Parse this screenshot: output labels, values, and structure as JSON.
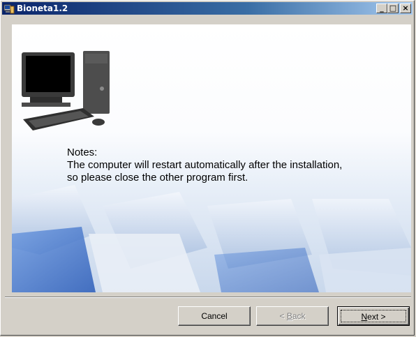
{
  "window": {
    "title": "Bioneta1.2",
    "controls": {
      "minimize": "_",
      "maximize": "□",
      "close": "×"
    }
  },
  "notes": {
    "heading": "Notes:",
    "line1": "The computer will restart automatically after the installation,",
    "line2": "so please close the other program first."
  },
  "buttons": {
    "cancel": "Cancel",
    "back_prefix": "< ",
    "back_accel": "B",
    "back_rest": "ack",
    "next_accel": "N",
    "next_rest": "ext >"
  }
}
